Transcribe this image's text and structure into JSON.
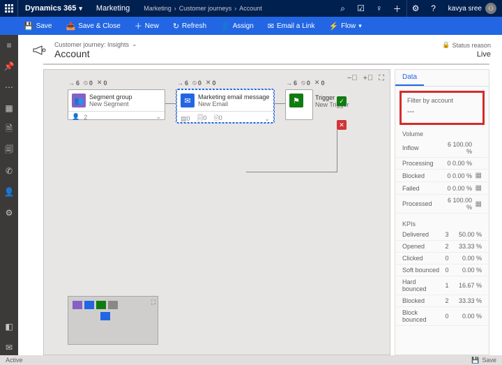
{
  "topbar": {
    "brand": "Dynamics 365",
    "section": "Marketing",
    "crumb1": "Marketing",
    "crumb2": "Customer journeys",
    "crumb3": "Account",
    "user": "kavya sree"
  },
  "cmd": {
    "save": "Save",
    "saveclose": "Save & Close",
    "new": "New",
    "refresh": "Refresh",
    "assign": "Assign",
    "email": "Email a Link",
    "flow": "Flow"
  },
  "hdr": {
    "sub": "Customer journey: Insights",
    "title": "Account",
    "statuslabel": "Status reason",
    "status": "Live"
  },
  "tiles": {
    "seg": {
      "title": "Segment group",
      "sub": "New Segment",
      "foot": "2",
      "a": "6",
      "b": "0",
      "c": "0"
    },
    "mail": {
      "title": "Marketing email message",
      "sub": "New Email",
      "f1": "0",
      "f2": "0",
      "f3": "0",
      "a": "6",
      "b": "0",
      "c": "0"
    },
    "trig": {
      "title": "Trigger",
      "sub": "New Trigger",
      "a": "6",
      "b": "0",
      "c": "0"
    }
  },
  "side": {
    "tab": "Data",
    "filter_label": "Filter by account",
    "filter_value": "---",
    "volume_title": "Volume",
    "kpi_title": "KPIs",
    "volume": [
      {
        "l": "Inflow",
        "v": "6 100.00 %"
      },
      {
        "l": "Processing",
        "v": "0 0.00 %"
      },
      {
        "l": "Blocked",
        "v": "0 0.00 %",
        "i": "▦"
      },
      {
        "l": "Failed",
        "v": "0 0.00 %",
        "i": "▦"
      },
      {
        "l": "Processed",
        "v": "6 100.00 %",
        "i": "▦"
      }
    ],
    "kpis": [
      {
        "l": "Delivered",
        "c": "3",
        "p": "50.00 %"
      },
      {
        "l": "Opened",
        "c": "2",
        "p": "33.33 %"
      },
      {
        "l": "Clicked",
        "c": "0",
        "p": "0.00 %"
      },
      {
        "l": "Soft bounced",
        "c": "0",
        "p": "0.00 %"
      },
      {
        "l": "Hard bounced",
        "c": "1",
        "p": "16.67 %"
      },
      {
        "l": "Blocked",
        "c": "2",
        "p": "33.33 %"
      },
      {
        "l": "Block bounced",
        "c": "0",
        "p": "0.00 %"
      }
    ]
  },
  "footer": {
    "active": "Active",
    "save": "Save"
  }
}
